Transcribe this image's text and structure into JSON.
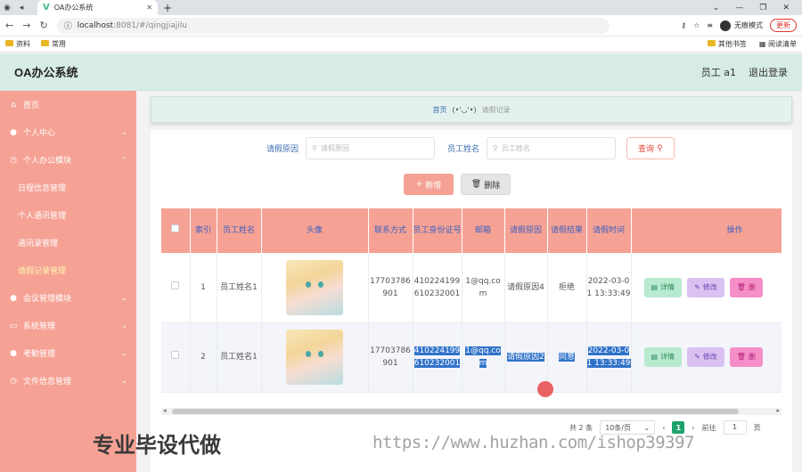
{
  "browser": {
    "tab_title": "OA办公系统",
    "url_host": "localhost",
    "url_rest": ":8081/#/qingjiajilu",
    "incognito_label": "无痕模式",
    "update_label": "更新",
    "bookmarks": [
      "资料",
      "常用"
    ],
    "bookmarks_right": [
      "其他书签",
      "阅读清单"
    ]
  },
  "app": {
    "title": "OA办公系统",
    "user_label": "员工 a1",
    "logout_label": "退出登录"
  },
  "sidebar": {
    "items": [
      {
        "label": "首页",
        "icon": "home-icon"
      },
      {
        "label": "个人中心",
        "icon": "user-icon"
      },
      {
        "label": "个人办公模块",
        "icon": "clock-icon"
      },
      {
        "label": "日程信息管理"
      },
      {
        "label": "个人通讯管理"
      },
      {
        "label": "通讯录管理"
      },
      {
        "label": "请假记录管理"
      },
      {
        "label": "会议管理模块",
        "icon": "user-icon"
      },
      {
        "label": "系统管理",
        "icon": "monitor-icon"
      },
      {
        "label": "考勤管理",
        "icon": "user-icon"
      },
      {
        "label": "文件信息管理",
        "icon": "clock-icon"
      }
    ]
  },
  "breadcrumb": {
    "home": "首页",
    "emoticon": "(•'◡'•)",
    "current": "请假记录"
  },
  "search": {
    "reason_label": "请假原因",
    "reason_placeholder": "请假原因",
    "name_label": "员工姓名",
    "name_placeholder": "员工姓名",
    "query_label": "查询"
  },
  "toolbar": {
    "add_label": "新增",
    "delete_label": "删除"
  },
  "table": {
    "headers": [
      "索引",
      "员工姓名",
      "头像",
      "联系方式",
      "员工身份证号",
      "邮箱",
      "请假原因",
      "请假结果",
      "请假时间",
      "操作"
    ],
    "rows": [
      {
        "index": "1",
        "name": "员工姓名1",
        "phone": "17703786901",
        "idcard": "410224199610232001",
        "email": "1@qq.com",
        "reason": "请假原因4",
        "result": "拒绝",
        "time": "2022-03-01 13:33:49"
      },
      {
        "index": "2",
        "name": "员工姓名1",
        "phone": "17703786901",
        "idcard": "410224199610232001",
        "email": "1@qq.com",
        "reason": "请假原因2",
        "result": "同意",
        "time": "2022-03-01 13:33:49"
      }
    ],
    "detail_label": "详情",
    "edit_label": "修改",
    "remove_label": "删"
  },
  "pagination": {
    "total_label": "共 2 条",
    "page_size": "10条/页",
    "current_page": "1",
    "goto_label": "前往",
    "goto_value": "1",
    "page_suffix": "页"
  },
  "watermark": {
    "text": "专业毕设代做",
    "url": "https://www.huzhan.com/ishop39397"
  }
}
